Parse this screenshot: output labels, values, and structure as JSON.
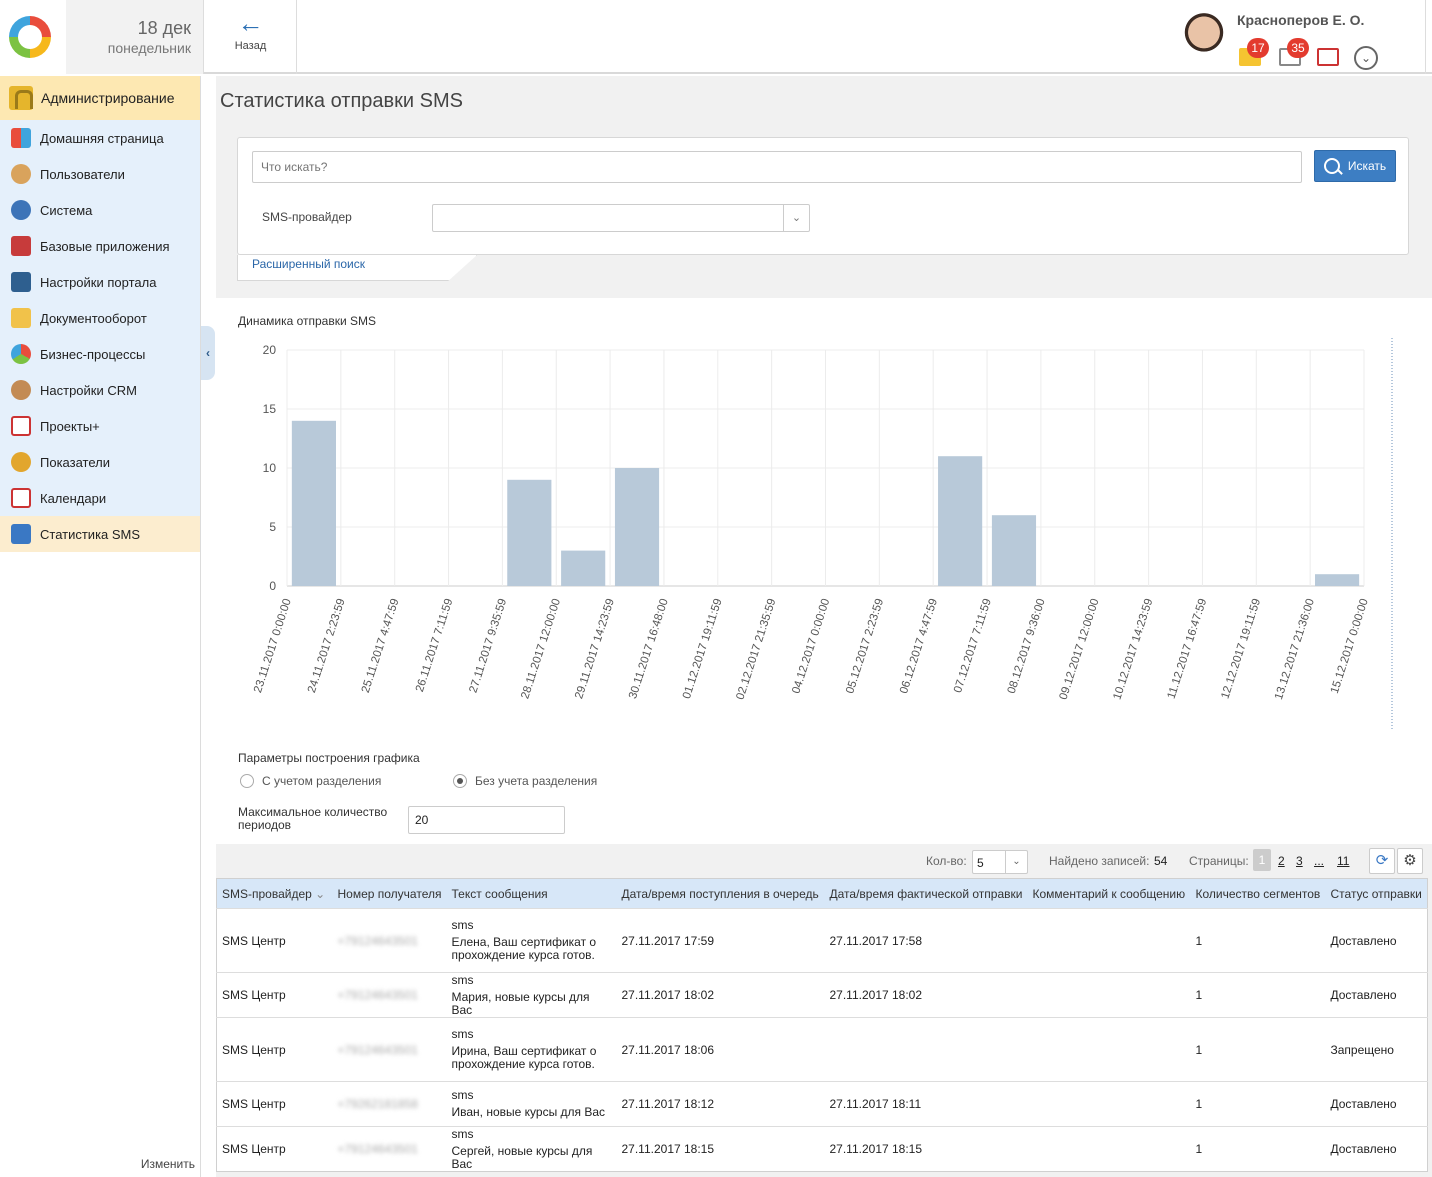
{
  "header": {
    "date_day": "18 дек",
    "date_weekday": "понедельник",
    "back_label": "Назад",
    "user_name": "Красноперов Е. О.",
    "mail_count": "17",
    "task_count": "35"
  },
  "sidebar": {
    "section_title": "Администрирование",
    "items": [
      {
        "label": "Домашняя страница",
        "icon": "home-grid-icon",
        "color": "#e94d3c"
      },
      {
        "label": "Пользователи",
        "icon": "users-icon",
        "color": "#d9a35c"
      },
      {
        "label": "Система",
        "icon": "system-icon",
        "color": "#3d74b8"
      },
      {
        "label": "Базовые приложения",
        "icon": "apps-icon",
        "color": "#c73b3b"
      },
      {
        "label": "Настройки портала",
        "icon": "portal-settings-icon",
        "color": "#2e5f8f"
      },
      {
        "label": "Документооборот",
        "icon": "folder-icon",
        "color": "#f1c24a"
      },
      {
        "label": "Бизнес-процессы",
        "icon": "bp-icon",
        "color": "#7cc242"
      },
      {
        "label": "Настройки CRM",
        "icon": "crm-icon",
        "color": "#c38b54"
      },
      {
        "label": "Проекты+",
        "icon": "projects-icon",
        "color": "#c33"
      },
      {
        "label": "Показатели",
        "icon": "gauge-icon",
        "color": "#e2a62d"
      },
      {
        "label": "Календари",
        "icon": "calendar-icon",
        "color": "#c33"
      },
      {
        "label": "Статистика SMS",
        "icon": "sms-icon",
        "color": "#3a78c4"
      }
    ],
    "footer": "Изменить"
  },
  "page": {
    "title": "Статистика отправки SMS"
  },
  "search": {
    "placeholder": "Что искать?",
    "button_label": "Искать",
    "provider_label": "SMS-провайдер",
    "provider_value": "",
    "advanced_link": "Расширенный поиск"
  },
  "chart": {
    "heading": "Динамика отправки SMS"
  },
  "chart_data": {
    "type": "bar",
    "categories": [
      "23.11.2017 0:00:00",
      "24.11.2017 2:23:59",
      "25.11.2017 4:47:59",
      "26.11.2017 7:11:59",
      "27.11.2017 9:35:59",
      "28.11.2017 12:00:00",
      "29.11.2017 14:23:59",
      "30.11.2017 16:48:00",
      "01.12.2017 19:11:59",
      "02.12.2017 21:35:59",
      "04.12.2017 0:00:00",
      "05.12.2017 2:23:59",
      "06.12.2017 4:47:59",
      "07.12.2017 7:11:59",
      "08.12.2017 9:36:00",
      "09.12.2017 12:00:00",
      "10.12.2017 14:23:59",
      "11.12.2017 16:47:59",
      "12.12.2017 19:11:59",
      "13.12.2017 21:36:00",
      "15.12.2017 0:00:00"
    ],
    "values": [
      14,
      0,
      0,
      0,
      9,
      3,
      10,
      0,
      0,
      0,
      0,
      0,
      11,
      6,
      0,
      0,
      0,
      0,
      0,
      1
    ],
    "yticks": [
      0,
      5,
      10,
      15,
      20
    ],
    "ylim": [
      0,
      20
    ],
    "bar_color": "#b8c9d9",
    "grid": true
  },
  "params": {
    "title": "Параметры построения графика",
    "option_split": "С учетом разделения",
    "option_nosplit": "Без учета разделения",
    "selected": "nosplit",
    "max_periods_label": "Максимальное количество периодов",
    "max_periods_value": "20"
  },
  "toolbar": {
    "qty_label": "Кол-во:",
    "qty_value": "5",
    "found_label": "Найдено записей:",
    "found_value": "54",
    "pages_label": "Страницы:",
    "pages": [
      "1",
      "2",
      "3",
      "...",
      "11"
    ]
  },
  "table": {
    "columns": [
      "SMS-провайдер",
      "Номер получателя",
      "Текст сообщения",
      "Дата/время поступления в очередь",
      "Дата/время фактической отправки",
      "Комментарий к сообщению",
      "Количество сегментов",
      "Статус отправки"
    ],
    "rows": [
      {
        "provider": "SMS Центр",
        "phone": "+79124643501",
        "kind": "sms",
        "text": "Елена, Ваш сертификат о прохождение курса готов.",
        "queued": "27.11.2017 17:59",
        "sent": "27.11.2017 17:58",
        "comment": "",
        "segments": "1",
        "status": "Доставлено"
      },
      {
        "provider": "SMS Центр",
        "phone": "+79124643501",
        "kind": "sms",
        "text": "Мария, новые курсы для Вас",
        "queued": "27.11.2017 18:02",
        "sent": "27.11.2017 18:02",
        "comment": "",
        "segments": "1",
        "status": "Доставлено"
      },
      {
        "provider": "SMS Центр",
        "phone": "+79124643501",
        "kind": "sms",
        "text": "Ирина, Ваш сертификат о прохождение курса готов.",
        "queued": "27.11.2017 18:06",
        "sent": "",
        "comment": "",
        "segments": "1",
        "status": "Запрещено"
      },
      {
        "provider": "SMS Центр",
        "phone": "+79262181858",
        "kind": "sms",
        "text": "Иван, новые курсы для Вас",
        "queued": "27.11.2017 18:12",
        "sent": "27.11.2017 18:11",
        "comment": "",
        "segments": "1",
        "status": "Доставлено"
      },
      {
        "provider": "SMS Центр",
        "phone": "+79124643501",
        "kind": "sms",
        "text": "Сергей, новые курсы для Вас",
        "queued": "27.11.2017 18:15",
        "sent": "27.11.2017 18:15",
        "comment": "",
        "segments": "1",
        "status": "Доставлено"
      }
    ]
  }
}
